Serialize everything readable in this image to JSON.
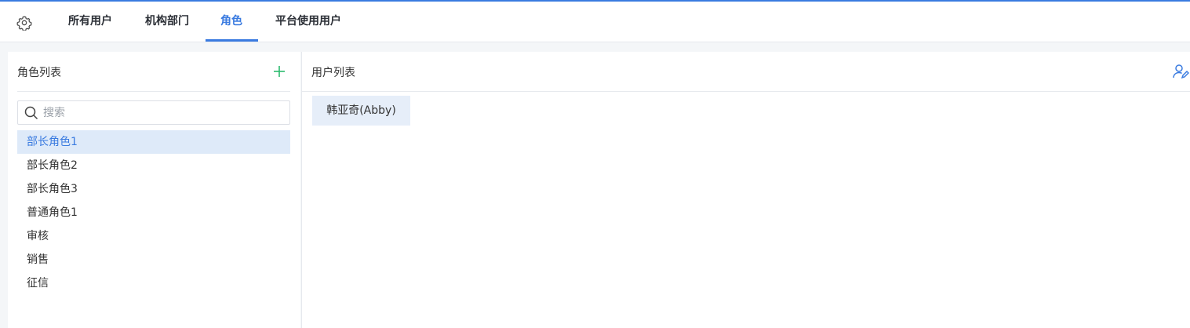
{
  "colors": {
    "accent": "#3a7be0",
    "add": "#2cbb6e",
    "selected_bg": "#deeaf9",
    "chip_bg": "#e6eef9"
  },
  "tabs": [
    {
      "label": "所有用户",
      "active": false
    },
    {
      "label": "机构部门",
      "active": false
    },
    {
      "label": "角色",
      "active": true
    },
    {
      "label": "平台使用用户",
      "active": false
    }
  ],
  "left_panel": {
    "title": "角色列表",
    "add_icon": "plus-icon",
    "search": {
      "placeholder": "搜索",
      "value": ""
    },
    "roles": [
      {
        "label": "部长角色1",
        "selected": true
      },
      {
        "label": "部长角色2",
        "selected": false
      },
      {
        "label": "部长角色3",
        "selected": false
      },
      {
        "label": "普通角色1",
        "selected": false
      },
      {
        "label": "审核",
        "selected": false
      },
      {
        "label": "销售",
        "selected": false
      },
      {
        "label": "征信",
        "selected": false
      }
    ]
  },
  "right_panel": {
    "title": "用户列表",
    "action_icon": "user-edit-icon",
    "users": [
      "韩亚奇(Abby)"
    ]
  }
}
